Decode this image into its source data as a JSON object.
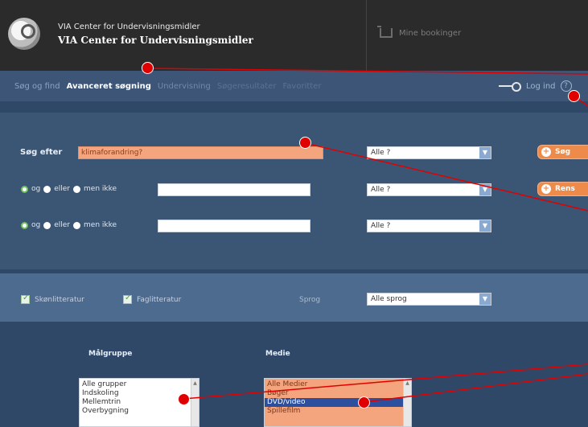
{
  "header": {
    "brand_line1": "VIA Center for Undervisningsmidler",
    "brand_line2": "VIA Center for Undervisningsmidler",
    "bookings_label": "Mine bookinger"
  },
  "nav": {
    "items": [
      "Søg og find",
      "Avanceret søgning",
      "Undervisning",
      "Søgeresultater",
      "Favoritter"
    ],
    "login_label": "Log ind",
    "help_label": "?"
  },
  "search": {
    "label": "Søg efter",
    "query_value": "klimaforandring?",
    "row_options": [
      "og",
      "eller",
      "men ikke"
    ],
    "select_value": "Alle ?",
    "search_button": "Søg",
    "reset_button": "Rens"
  },
  "filters": {
    "fiction": "Skønlitteratur",
    "nonfiction": "Faglitteratur",
    "language_label": "Sprog",
    "language_value": "Alle sprog"
  },
  "target_group": {
    "header": "Målgruppe",
    "items": [
      "Alle grupper",
      "Indskoling",
      "Mellemtrin",
      "Overbygning"
    ]
  },
  "media": {
    "header": "Medie",
    "items": [
      "Alle Medier",
      "Bøger",
      "DVD/video",
      "Spillefilm"
    ],
    "selected_index": 2
  },
  "colors": {
    "accent_orange": "#ee8a4a",
    "field_highlight": "#f4a57e",
    "annotation_red": "#e10000",
    "panel_blue": "#3b5574"
  }
}
